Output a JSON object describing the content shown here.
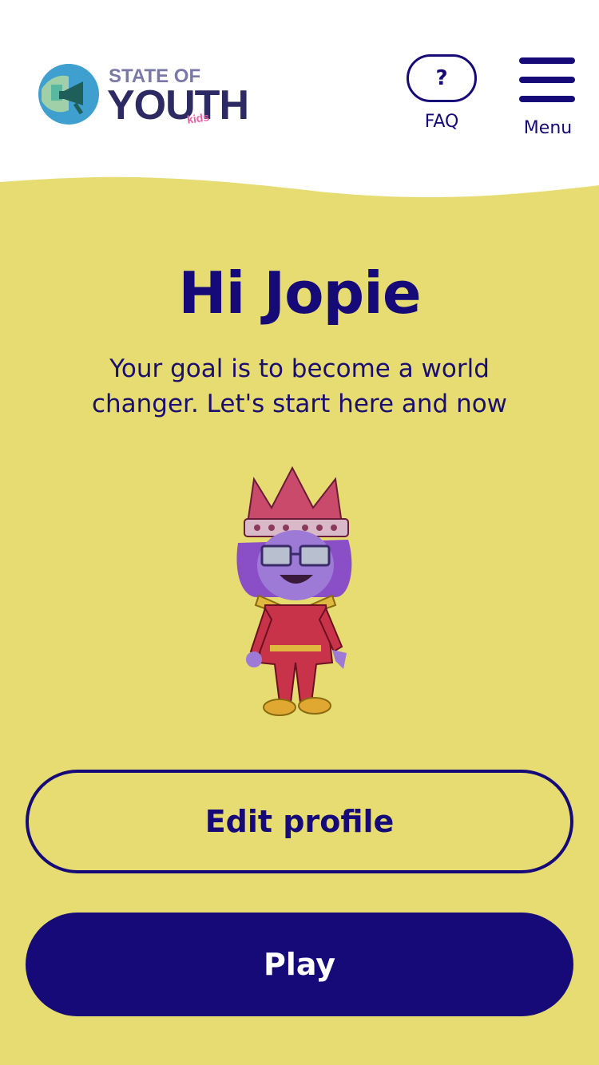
{
  "header": {
    "logo": {
      "line1": "STATE OF",
      "line2": "YOUTH",
      "line3": "kids"
    },
    "faq": {
      "icon": "question-mark-icon",
      "symbol": "?",
      "label": "FAQ"
    },
    "menu": {
      "icon": "hamburger-menu-icon",
      "label": "Menu"
    }
  },
  "main": {
    "greeting": "Hi Jopie",
    "subtitle": "Your goal is to become a world changer. Let's start here and now",
    "avatar": "superhero-avatar"
  },
  "buttons": {
    "edit_profile": "Edit profile",
    "play": "Play"
  },
  "colors": {
    "background": "#e6dc72",
    "primary": "#150a78",
    "header_bg": "#ffffff"
  }
}
